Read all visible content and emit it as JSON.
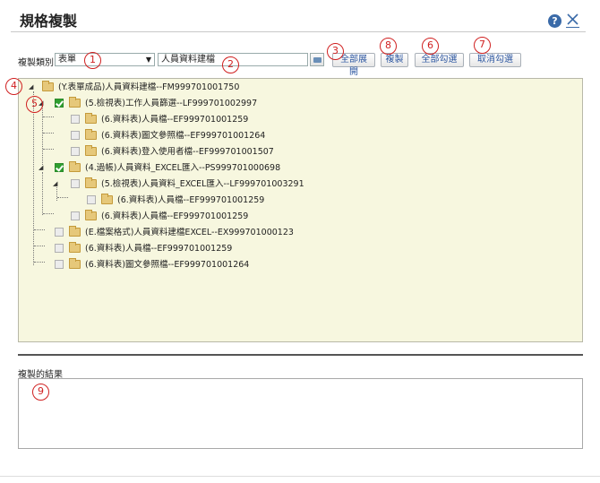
{
  "window": {
    "title": "規格複製",
    "help_symbol": "?",
    "close_symbol": "✕"
  },
  "toolbar": {
    "type_label": "複製類別",
    "type_select_value": "表單",
    "name_input_value": "人員資料建檔",
    "buttons": {
      "expand_all": "全部展開",
      "copy": "複製",
      "check_all": "全部勾選",
      "uncheck": "取消勾選"
    }
  },
  "tree": {
    "nodes": [
      {
        "label": "(Y.表單成品)人員資料建檔--FM999701001750",
        "checkbox": false,
        "checked": false,
        "expander": "minus"
      },
      {
        "label": "(5.檢視表)工作人員篩選--LF999701002997",
        "checkbox": true,
        "checked": true,
        "expander": "minus"
      },
      {
        "label": "(6.資料表)人員檔--EF999701001259",
        "checkbox": true,
        "checked": false,
        "expander": ""
      },
      {
        "label": "(6.資料表)圖文參照檔--EF999701001264",
        "checkbox": true,
        "checked": false,
        "expander": ""
      },
      {
        "label": "(6.資料表)登入使用者檔--EF999701001507",
        "checkbox": true,
        "checked": false,
        "expander": ""
      },
      {
        "label": "(4.過帳)人員資料_EXCEL匯入--PS999701000698",
        "checkbox": true,
        "checked": true,
        "expander": "minus"
      },
      {
        "label": "(5.檢視表)人員資料_EXCEL匯入--LF999701003291",
        "checkbox": true,
        "checked": false,
        "expander": "minus"
      },
      {
        "label": "(6.資料表)人員檔--EF999701001259",
        "checkbox": true,
        "checked": false,
        "expander": ""
      },
      {
        "label": "(6.資料表)人員檔--EF999701001259",
        "checkbox": true,
        "checked": false,
        "expander": ""
      },
      {
        "label": "(E.檔案格式)人員資料建檔EXCEL--EX999701000123",
        "checkbox": true,
        "checked": false,
        "expander": ""
      },
      {
        "label": "(6.資料表)人員檔--EF999701001259",
        "checkbox": true,
        "checked": false,
        "expander": ""
      },
      {
        "label": "(6.資料表)圖文參照檔--EF999701001264",
        "checkbox": true,
        "checked": false,
        "expander": ""
      }
    ]
  },
  "result": {
    "label": "複製的結果",
    "value": ""
  },
  "annotations": [
    "1",
    "2",
    "3",
    "4",
    "5",
    "6",
    "7",
    "8",
    "9"
  ],
  "colors": {
    "tree_background": "#f7f7df",
    "check_green": "#2f9e2f",
    "annotation_red": "#d02020",
    "link_blue": "#2c56a0"
  }
}
